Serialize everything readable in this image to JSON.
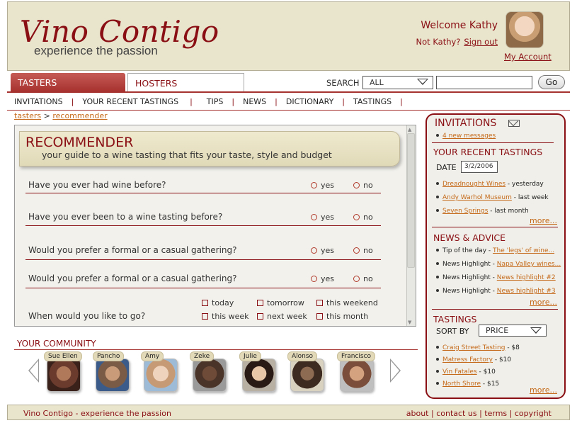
{
  "header": {
    "logo_main": "Vino Contigo",
    "logo_tag": "experience the passion",
    "welcome": "Welcome Kathy",
    "not_kathy": "Not Kathy?",
    "sign_out": "Sign out",
    "my_account": "My Account"
  },
  "tabs": {
    "tasters": "TASTERS",
    "hosters": "HOSTERS"
  },
  "search": {
    "label": "SEARCH",
    "scope": "ALL",
    "value": "",
    "go": "Go"
  },
  "subnav": [
    "INVITATIONS",
    "YOUR RECENT TASTINGS",
    "TIPS",
    "NEWS",
    "DICTIONARY",
    "TASTINGS"
  ],
  "breadcrumb": {
    "root": "tasters",
    "current": "recommender",
    "sep": ">"
  },
  "recommender": {
    "title": "RECOMMENDER",
    "subtitle": "your guide to a wine tasting that fits your taste, style and budget",
    "questions": [
      {
        "text": "Have you ever had wine before?",
        "opt1": "yes",
        "opt2": "no"
      },
      {
        "text": "Have you ever been to a wine tasting before?",
        "opt1": "yes",
        "opt2": "no"
      },
      {
        "text": "Would you prefer a formal or a casual gathering?",
        "opt1": "yes",
        "opt2": "no"
      },
      {
        "text": "Would you prefer a formal or a casual gathering?",
        "opt1": "yes",
        "opt2": "no"
      }
    ],
    "when": {
      "text": "When would you like to go?",
      "options": [
        "today",
        "tomorrow",
        "this weekend",
        "this week",
        "next week",
        "this month"
      ]
    }
  },
  "community": {
    "title": "YOUR COMMUNITY",
    "members": [
      {
        "name": "Sue Ellen",
        "color": "#6b3b2e"
      },
      {
        "name": "Pancho",
        "color": "#7a5b45"
      },
      {
        "name": "Amy",
        "color": "#c79a76"
      },
      {
        "name": "Zeke",
        "color": "#4a3328"
      },
      {
        "name": "Julie",
        "color": "#5a3e32"
      },
      {
        "name": "Alonso",
        "color": "#3d2b22"
      },
      {
        "name": "Francisco",
        "color": "#7a4e3a"
      }
    ]
  },
  "sidebar": {
    "invitations": {
      "title": "INVITATIONS",
      "messages": "4 new messages"
    },
    "recent": {
      "title": "YOUR RECENT TASTINGS",
      "date_label": "DATE",
      "date_value": "3/2/2006",
      "items": [
        {
          "link": "Dreadnought Wines",
          "rest": " - yesterday"
        },
        {
          "link": "Andy Warhol Museum",
          "rest": " - last week"
        },
        {
          "link": "Seven Springs",
          "rest": " - last month"
        }
      ],
      "more": "more..."
    },
    "news": {
      "title": "NEWS & ADVICE",
      "items": [
        {
          "prefix": "Tip of the day - ",
          "link": "The 'legs' of wine..."
        },
        {
          "prefix": "News Highlight - ",
          "link": "Napa Valley wines..."
        },
        {
          "prefix": "News Highlight - ",
          "link": "News highlight #2"
        },
        {
          "prefix": "News Highlight - ",
          "link": "News highlight #3"
        }
      ],
      "more": "more..."
    },
    "tastings": {
      "title": "TASTINGS",
      "sort_label": "SORT BY",
      "sort_value": "PRICE",
      "items": [
        {
          "link": "Craig Street Tasting",
          "rest": " - $8"
        },
        {
          "link": "Matress Factory",
          "rest": " - $10"
        },
        {
          "link": "Vin Fatales",
          "rest": " - $10"
        },
        {
          "link": "North Shore",
          "rest": " - $15"
        }
      ],
      "more": "more..."
    }
  },
  "footer": {
    "left": "Vino Contigo - experience the passion",
    "links": [
      "about",
      "contact us",
      "terms",
      "copyright"
    ],
    "sep": "|"
  },
  "colors": {
    "brand": "#8a0f14",
    "header_bg": "#e9e4cc",
    "link_orange": "#c56a1a",
    "tab_active": "#a8322f"
  }
}
